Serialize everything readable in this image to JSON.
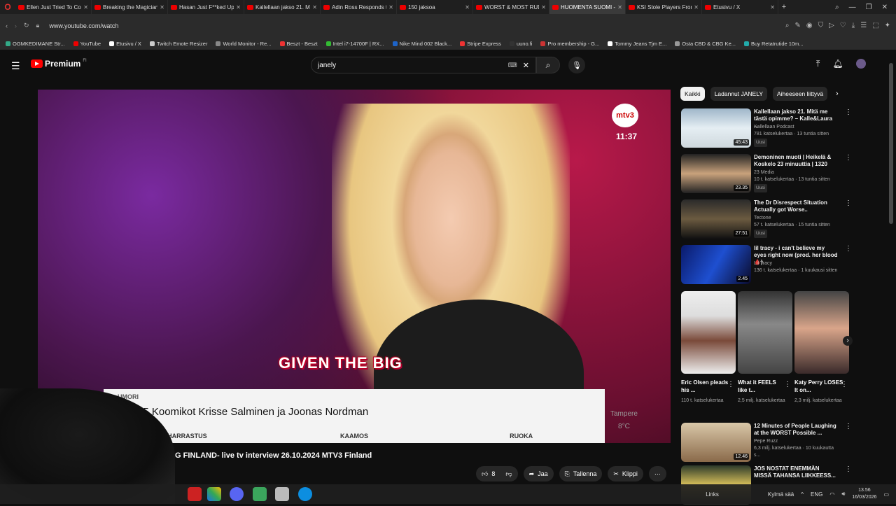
{
  "browser": {
    "tabs": [
      "Ellen Just Tried To Come",
      "Breaking the Magician's",
      "Hasan Just F**ked Up Re",
      "Kallellaan jakso 21. Mit",
      "Adin Ross Responds to G",
      "150 jaksoa",
      "WORST & MOST RUDE C",
      "HUOMENTA SUOMI - GO",
      "KSI Stole Players From S",
      "Etusivu / X"
    ],
    "active_tab_index": 7,
    "url": "www.youtube.com/watch",
    "bookmarks": [
      "OGMKEDIMANE Str...",
      "YouTube",
      "Etusivu / X",
      "Twitch Emote Resizer",
      "World Monitor - Re...",
      "Beszt - Beszt",
      "Intel i7-14700F | RX...",
      "Nike Mind 002 Black...",
      "Stripe Express",
      "uuno.fi",
      "Pro membership - G...",
      "Tommy Jeans Tjm E...",
      "Osta CBD & CBG Ke...",
      "Buy Retatrutide 10m..."
    ]
  },
  "youtube": {
    "logo": "Premium",
    "logo_region": "FI",
    "search_value": "janely"
  },
  "video": {
    "channel_logo": "mtv3",
    "clock": "11:37",
    "caption": "GIVEN THE BIG",
    "lower_kicker": "UMORI",
    "lower_headline": "35 Koomikot Krisse Salminen ja Joonas Nordman",
    "categories": [
      "HARRASTUS",
      "KAAMOS",
      "RUOKA"
    ],
    "weather_city": "Tampere",
    "weather_temp": "8°C",
    "title": "IG FINLAND- live tv interview 26.10.2024 MTV3 Finland",
    "likes": "8",
    "share": "Jaa",
    "save": "Tallenna",
    "clip": "Klippi"
  },
  "chips": [
    "Kaikki",
    "Ladannut JANELY",
    "Aiheeseen liittyvä"
  ],
  "recommendations": [
    {
      "title": "Kallellaan jakso 21. Mitä me tästä opimme? – Kalle&Laura ...",
      "channel": "Kallellaan Podcast",
      "meta": "781 katselukertaa · 13 tuntia sitten",
      "badge": "Uusi",
      "duration": "45:43"
    },
    {
      "title": "Demoninen muoti | Heikelä & Koskelo 23 minuuttia | 1320",
      "channel": "23 Media",
      "meta": "10 t. katselukertaa · 13 tuntia sitten",
      "badge": "Uusi",
      "duration": "23.35"
    },
    {
      "title": "The Dr Disrespect Situation Actually got Worse..",
      "channel": "Tectone",
      "meta": "57 t. katselukertaa · 15 tuntia sitten",
      "badge": "Uusi",
      "duration": "27:51"
    },
    {
      "title": "lil tracy - i can't believe my eyes right now (prod. her blood 🩸)",
      "channel": "Lil Tracy",
      "meta": "136 t. katselukertaa · 1 kuukausi sitten",
      "badge": "",
      "duration": "2.45"
    }
  ],
  "shorts": [
    {
      "title": "Eric Olsen pleads his ...",
      "meta": "110 t. katselukertaa"
    },
    {
      "title": "What it FEELS like t...",
      "meta": "2,5 milj. katselukertaa"
    },
    {
      "title": "Katy Perry LOSES It on...",
      "meta": "2,3 milj. katselukertaa"
    }
  ],
  "rec_bottom": [
    {
      "title": "12 Minutes of People Laughing at the WORST Possible ...",
      "channel": "Pepe Ruzz",
      "meta": "6,3 milj. katselukertaa · 10 kuukautta s...",
      "duration": "12.46"
    },
    {
      "title": "JOS NOSTAT ENEMMÄN MISSÄ TAHANSA LIIKKEESS...",
      "channel": "",
      "meta": "",
      "duration": ""
    }
  ],
  "taskbar": {
    "links": "Links",
    "weather": "Kylmä sää",
    "lang": "ENG",
    "time": "13.56",
    "date": "16/03/2026"
  }
}
